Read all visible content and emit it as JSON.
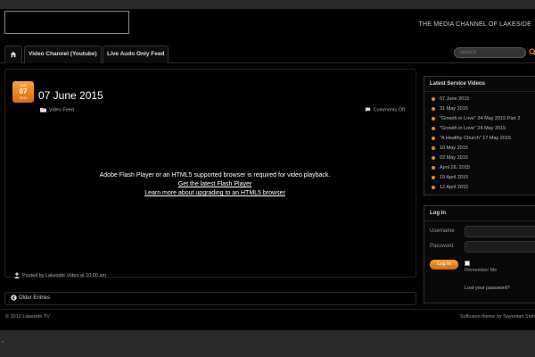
{
  "header": {
    "tagline": "THE MEDIA CHANNEL OF LAKESIDE"
  },
  "nav": {
    "home_icon": "home-icon",
    "items": [
      "Video Channel (Youtube)",
      "Live Audo Only Feed"
    ]
  },
  "search": {
    "placeholder": "Search",
    "icon": "search-icon"
  },
  "post": {
    "date_month": "JUN",
    "date_day": "07",
    "date_year": "2015",
    "title": "07 June 2015",
    "category": "Video Feed",
    "comments": "Comments Off",
    "flash_message": "Adobe Flash Player or an HTML5 supported browser is required for video playback.",
    "flash_link_1": "Get the latest Flash Player",
    "flash_link_2": "Learn more about upgrading to an HTML5 browser",
    "posted_by": "Posted by Lakeside Video at 10:00 am"
  },
  "older_entries": "Older Entries",
  "sidebar": {
    "videos_title": "Latest Service Videos",
    "videos": [
      "07 June 2015",
      "31 May 2015",
      "\"Growth in Love\" 24 May 2015 Part 2",
      "\"Growth in Love\" 24 May 2015",
      "\"A Healthy Church\" 17 May 2015",
      "10 May 2015",
      "03 May 2015",
      "April 26, 2015",
      "19 April 2015",
      "12 April 2015"
    ],
    "login_title": "Log In",
    "username_label": "Username",
    "password_label": "Password",
    "login_button": "Log In",
    "remember_label": "Remember Me",
    "lost_password": "Lost your password?"
  },
  "footer": {
    "copyright": "© 2012 Lakeside TV",
    "credit": "Suffusion theme by Sayontan Sinh"
  },
  "colors": {
    "accent": "#e88a1a",
    "background": "#000000",
    "page": "#2a2a2a"
  }
}
